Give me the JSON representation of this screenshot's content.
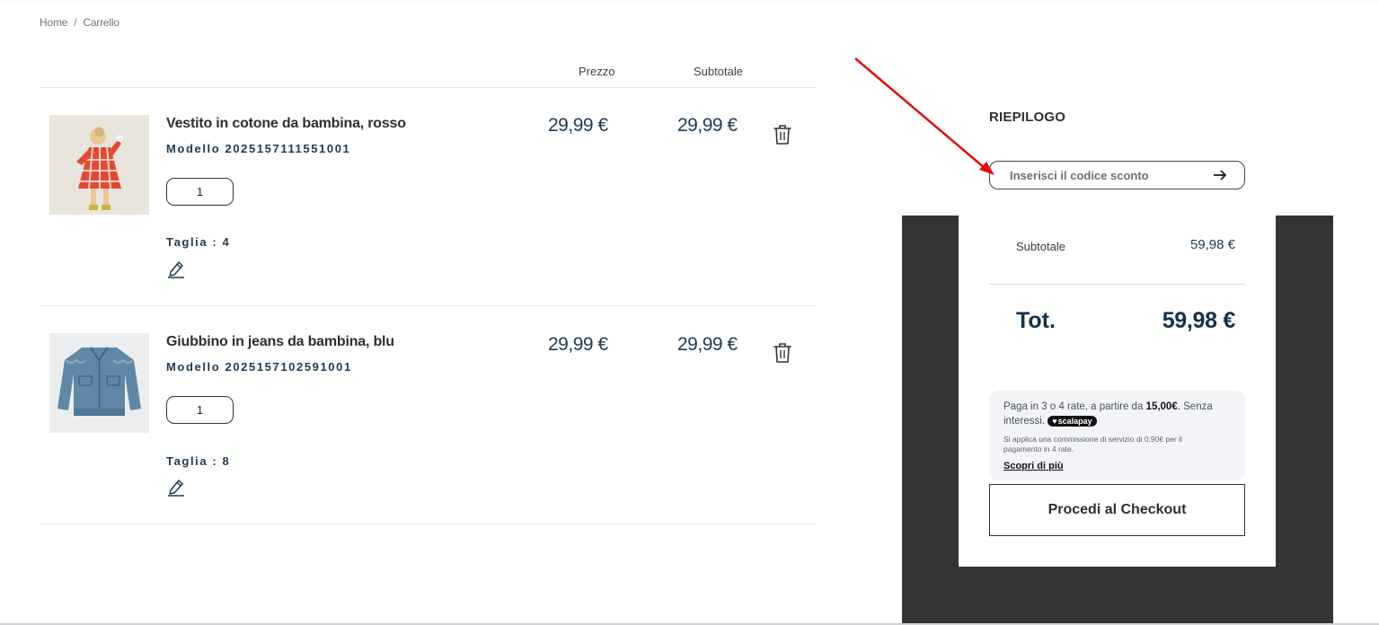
{
  "breadcrumb": {
    "home": "Home",
    "separator": "/",
    "current": "Carrello"
  },
  "table": {
    "price_header": "Prezzo",
    "subtotal_header": "Subtotale"
  },
  "items": [
    {
      "name": "Vestito in cotone da bambina, rosso",
      "model": "Modello 2025157111551001",
      "quantity": "1",
      "size": "Taglia : 4",
      "price": "29,99 €",
      "subtotal": "29,99 €",
      "image_icon": "red-checked-dress-photo"
    },
    {
      "name": "Giubbino in jeans da bambina, blu",
      "model": "Modello 2025157102591001",
      "quantity": "1",
      "size": "Taglia : 8",
      "price": "29,99 €",
      "subtotal": "29,99 €",
      "image_icon": "denim-jacket-photo"
    }
  ],
  "summary": {
    "title": "RIEPILOGO",
    "discount_placeholder": "Inserisci il codice sconto",
    "subtotal_label": "Subtotale",
    "subtotal_value": "59,98 €",
    "total_label": "Tot.",
    "total_value": "59,98 €",
    "scalapay": {
      "text_before": "Paga in 3 o 4 rate, a partire da ",
      "amount": "15,00€",
      "text_after": ". Senza interessi.",
      "badge": "scalapay",
      "note": "Si applica una commissione di servizio di 0,90€ per il pagamento in 4 rate.",
      "link": "Scopri di più"
    },
    "checkout_label": "Procedi al Checkout"
  },
  "colors": {
    "accent_text": "#1c3b52",
    "dark_panel": "#333534",
    "annotation_arrow": "#e01010"
  }
}
